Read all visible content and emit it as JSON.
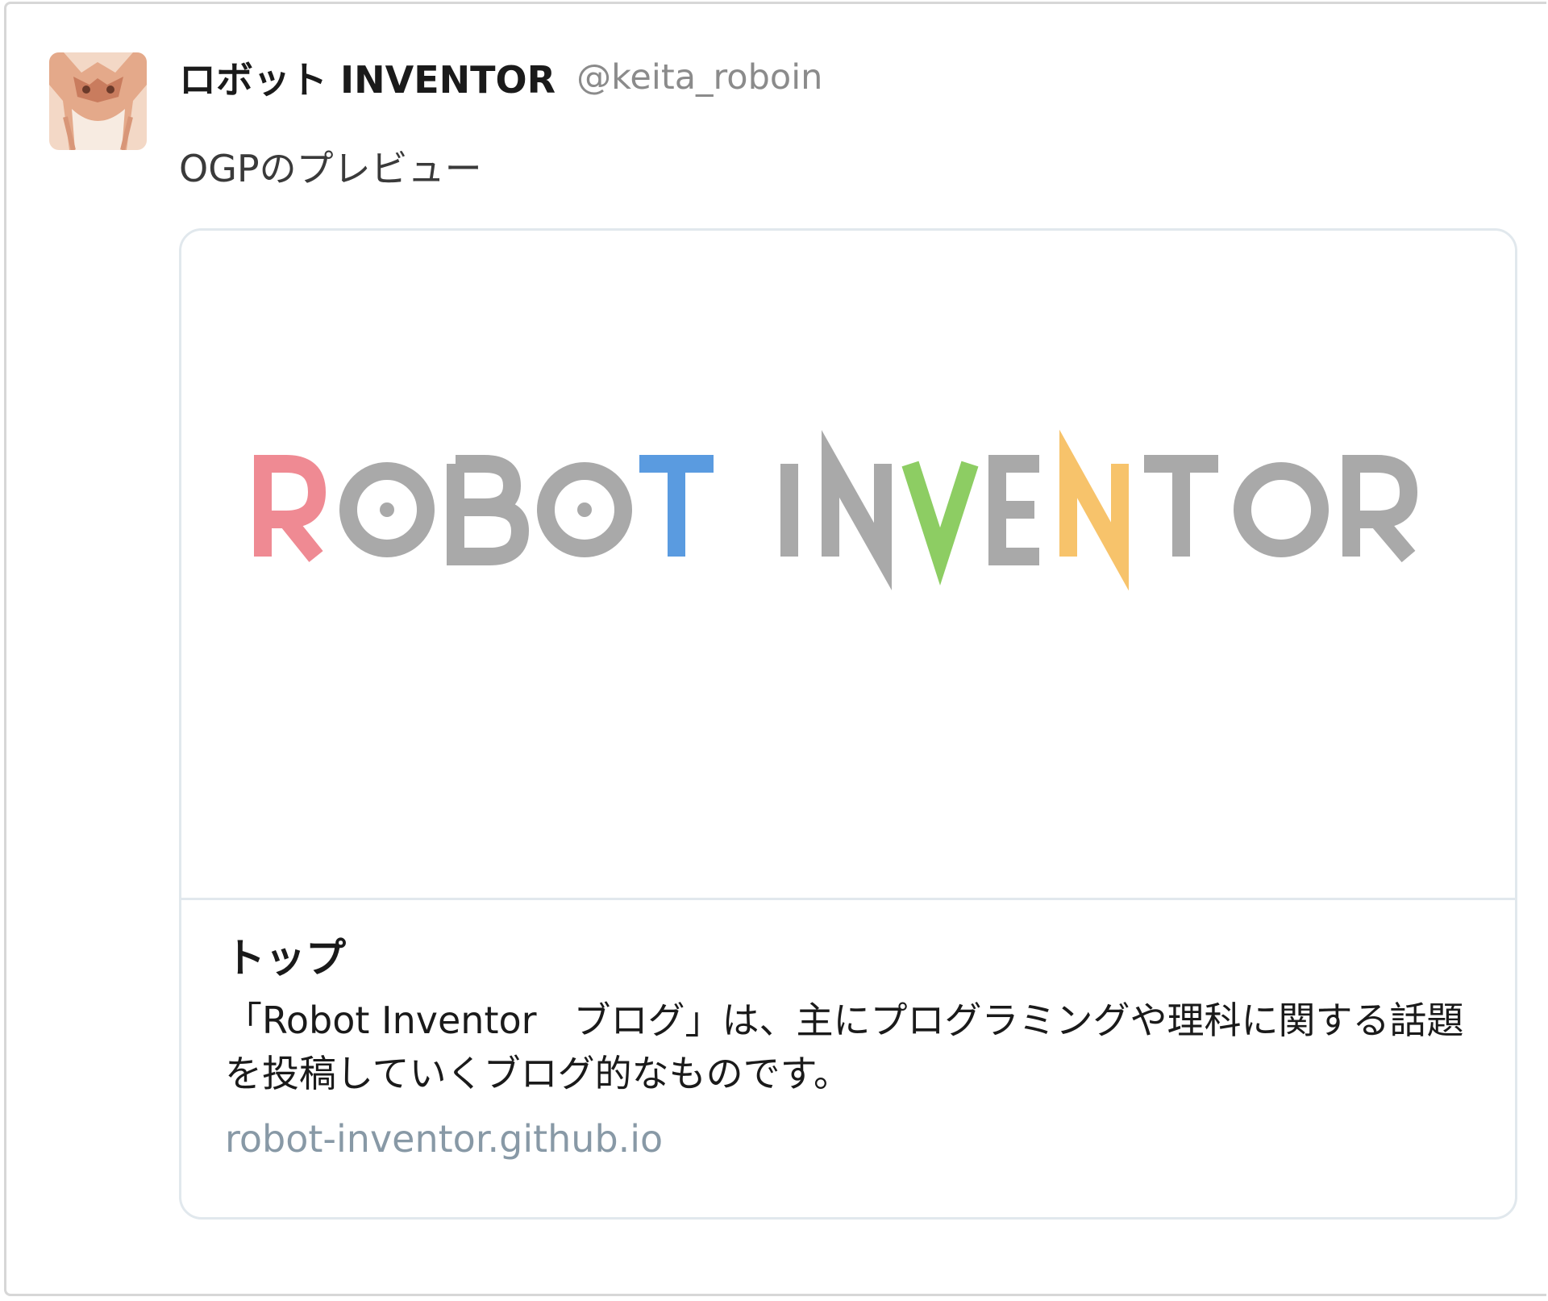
{
  "tweet": {
    "author": {
      "display_name": "ロボット INVENTOR",
      "handle": "@keita_roboin",
      "avatar_icon": "avatar-icon"
    },
    "text": "OGPのプレビュー"
  },
  "card": {
    "image": {
      "logo_text": "ROBOT INVENTOR",
      "letter_colors": {
        "gray": "#a9a9a9",
        "red": "#ef8a93",
        "blue": "#5a9be0",
        "green": "#8dcd63",
        "yellow": "#f7c36b"
      }
    },
    "title": "トップ",
    "description": "「Robot Inventor　ブログ」は、主にプログラミングや理科に関する話題を投稿していくブログ的なものです。",
    "domain": "robot-inventor.github.io"
  }
}
